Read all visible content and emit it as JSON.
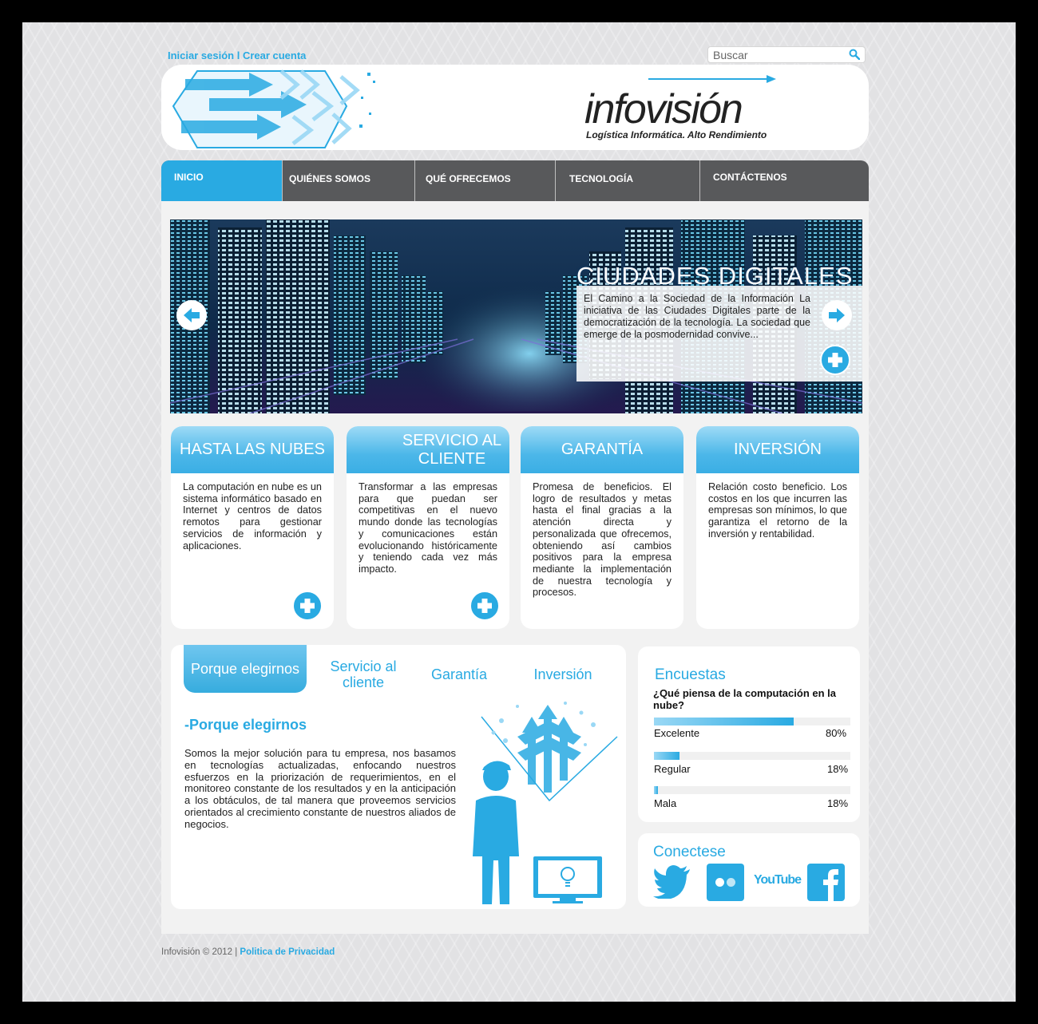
{
  "top_links": {
    "login": "Iniciar sesión",
    "separator": " l ",
    "signup": "Crear cuenta"
  },
  "search": {
    "placeholder": "Buscar",
    "icon": "search-icon"
  },
  "brand": {
    "name": "infovisión",
    "tagline": "Logística Informática. Alto Rendimiento"
  },
  "nav": [
    {
      "label": "INICIO",
      "active": true
    },
    {
      "label": "QUIÉNES SOMOS"
    },
    {
      "label": "QUÉ OFRECEMOS"
    },
    {
      "label": "TECNOLOGÍA"
    },
    {
      "label": "CONTÁCTENOS"
    }
  ],
  "slider": {
    "title": "CIUDADES DIGITALES",
    "text": "El Camino a la Sociedad de la Información La iniciativa de las Ciudades Digitales parte de la democratización de la tecnología. La sociedad que emerge de la posmodernidad convive..."
  },
  "cards": [
    {
      "title": "HASTA LAS NUBES",
      "text": "La computación en nube es un sistema informático basado en Internet y centros de datos remotos para gestionar servicios de información y aplicaciones."
    },
    {
      "title": "SERVICIO AL CLIENTE",
      "text": "Transformar a las empresas para que puedan ser competitivas en el nuevo mundo donde las tecnologías y comunicaciones están evolucionando históricamente y teniendo cada vez más impacto."
    },
    {
      "title": "GARANTÍA",
      "text": "Promesa de beneficios. El logro de resultados y metas hasta el final gracias a la atención directa y personalizada que ofrecemos, obteniendo así cambios positivos para la empresa mediante la implementación de nuestra tecnología y procesos."
    },
    {
      "title": "INVERSIÓN",
      "text": "Relación costo beneficio. Los costos en los que incurren las empresas son mínimos, lo que garantiza el retorno de la inversión y rentabilidad."
    }
  ],
  "tabs": {
    "items": [
      "Porque elegirnos",
      "Servicio al cliente",
      "Garantía",
      "Inversión"
    ],
    "active_heading": "-Porque elegirnos",
    "active_text": "Somos la mejor solución para tu empresa, nos basamos en tecnologías actualizadas, enfocando nuestros esfuerzos en la priorización de requerimientos, en el monitoreo constante de los resultados y en la anticipación a los obtáculos, de tal manera que proveemos servicios orientados al crecimiento constante de nuestros aliados de negocios."
  },
  "poll": {
    "title": "Encuestas",
    "question": "¿Qué piensa de la computación en la nube?",
    "options": [
      {
        "label": "Excelente",
        "percent_text": "80%",
        "fill": 0.71
      },
      {
        "label": "Regular",
        "percent_text": "18%",
        "fill": 0.13
      },
      {
        "label": "Mala",
        "percent_text": "18%",
        "fill": 0.02
      }
    ]
  },
  "connect": {
    "title": "Conectese",
    "icons": [
      "twitter-icon",
      "flickr-icon",
      "youtube-icon",
      "facebook-icon"
    ],
    "youtube_text": "YouTube"
  },
  "footer": {
    "copyright": "Infovisión © 2012 | ",
    "privacy": "Politica de Privacidad"
  },
  "colors": {
    "accent": "#29aae2",
    "nav_bg": "#58595b",
    "dark": "#222222"
  }
}
